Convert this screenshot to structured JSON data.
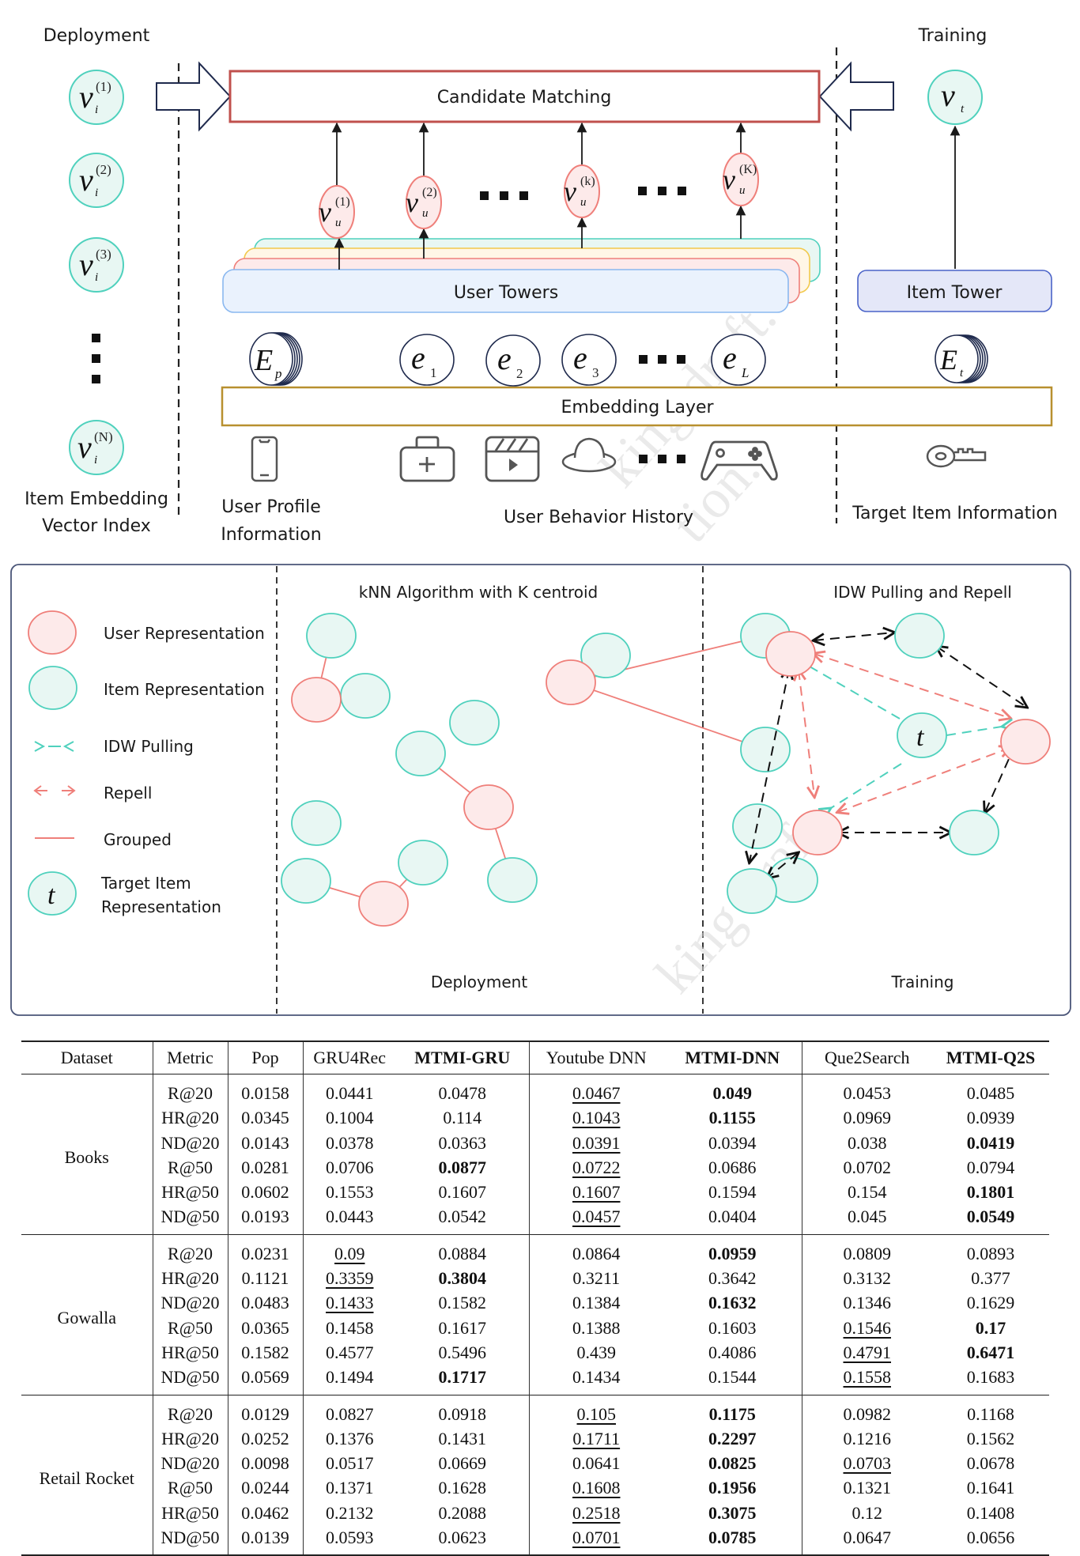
{
  "architecture": {
    "deployment_label": "Deployment",
    "training_label": "Training",
    "candidate_matching_label": "Candidate Matching",
    "user_towers_label": "User Towers",
    "item_tower_label": "Item Tower",
    "embedding_layer_label": "Embedding Layer",
    "item_index_label_line1": "Item Embedding",
    "item_index_label_line2": "Vector Index",
    "user_profile_label_line1": "User Profile",
    "user_profile_label_line2": "Information",
    "user_behavior_label": "User Behavior History",
    "target_item_label": "Target Item Information",
    "item_vectors": [
      {
        "base": "v",
        "sub": "i",
        "sup": "(1)"
      },
      {
        "base": "v",
        "sub": "i",
        "sup": "(2)"
      },
      {
        "base": "v",
        "sub": "i",
        "sup": "(3)"
      },
      {
        "base": "v",
        "sub": "i",
        "sup": "(N)"
      }
    ],
    "user_vectors": [
      {
        "base": "v",
        "sub": "u",
        "sup": "(1)"
      },
      {
        "base": "v",
        "sub": "u",
        "sup": "(2)"
      },
      {
        "base": "v",
        "sub": "u",
        "sup": "(k)"
      },
      {
        "base": "v",
        "sub": "u",
        "sup": "(K)"
      }
    ],
    "target_vector": {
      "base": "v",
      "sub": "t"
    },
    "profile_embedding": {
      "base": "E",
      "sub": "p"
    },
    "target_embedding": {
      "base": "E",
      "sub": "t"
    },
    "behavior_embeddings": [
      {
        "base": "e",
        "sub": "1"
      },
      {
        "base": "e",
        "sub": "2"
      },
      {
        "base": "e",
        "sub": "3"
      },
      {
        "base": "e",
        "sub": "L"
      }
    ],
    "behavior_icons": [
      "first-aid-kit-icon",
      "video-clapper-icon",
      "hat-icon",
      "game-controller-icon"
    ],
    "profile_icon": "smartphone-icon",
    "target_icon": "key-icon"
  },
  "legend": {
    "items": [
      {
        "label": "User Representation",
        "kind": "user"
      },
      {
        "label": "Item Representation",
        "kind": "item"
      },
      {
        "label": "IDW Pulling",
        "kind": "pull"
      },
      {
        "label": "Repell",
        "kind": "repel"
      },
      {
        "label": "Grouped",
        "kind": "grouped"
      },
      {
        "label_line1": "Target Item",
        "label_line2": "Representation",
        "kind": "target",
        "symbol": "t"
      }
    ]
  },
  "knn_panel": {
    "title": "kNN Algorithm with K centroid",
    "caption": "Deployment"
  },
  "idw_panel": {
    "title": "IDW Pulling and Repell",
    "caption": "Training",
    "target_symbol": "t"
  },
  "colors": {
    "user_fill": "#fdeaea",
    "user_stroke": "#ef7f7a",
    "item_fill": "#e8f7f3",
    "item_stroke": "#4fd1bd",
    "candidate_box": "#c0504d",
    "embedding_box": "#b8902f",
    "tower_blue_fill": "#eaf2fd",
    "tower_blue_stroke": "#8ab8f0",
    "item_tower_fill": "#e4e7f8",
    "item_tower_stroke": "#4a63c8",
    "arrow_navy": "#1f2a4d"
  },
  "watermark": [
    "king draft.",
    "tion."
  ],
  "table": {
    "headers": [
      {
        "label": "Dataset",
        "bold": false
      },
      {
        "label": "Metric",
        "bold": false
      },
      {
        "label": "Pop",
        "bold": false
      },
      {
        "label": "GRU4Rec",
        "bold": false
      },
      {
        "label": "MTMI-GRU",
        "bold": true
      },
      {
        "label": "Youtube DNN",
        "bold": false
      },
      {
        "label": "MTMI-DNN",
        "bold": true
      },
      {
        "label": "Que2Search",
        "bold": false
      },
      {
        "label": "MTMI-Q2S",
        "bold": true
      }
    ],
    "groups": [
      {
        "dataset": "Books",
        "rows": [
          {
            "metric": "R@20",
            "values": [
              "0.0158",
              "0.0441",
              "0.0478",
              "0.0467",
              "0.049",
              "0.0453",
              "0.0485"
            ],
            "bold": [
              4
            ],
            "underline": [
              3
            ]
          },
          {
            "metric": "HR@20",
            "values": [
              "0.0345",
              "0.1004",
              "0.114",
              "0.1043",
              "0.1155",
              "0.0969",
              "0.0939"
            ],
            "bold": [
              4
            ],
            "underline": [
              3
            ]
          },
          {
            "metric": "ND@20",
            "values": [
              "0.0143",
              "0.0378",
              "0.0363",
              "0.0391",
              "0.0394",
              "0.038",
              "0.0419"
            ],
            "bold": [
              6
            ],
            "underline": [
              3
            ]
          },
          {
            "metric": "R@50",
            "values": [
              "0.0281",
              "0.0706",
              "0.0877",
              "0.0722",
              "0.0686",
              "0.0702",
              "0.0794"
            ],
            "bold": [
              2
            ],
            "underline": [
              3
            ]
          },
          {
            "metric": "HR@50",
            "values": [
              "0.0602",
              "0.1553",
              "0.1607",
              "0.1607",
              "0.1594",
              "0.154",
              "0.1801"
            ],
            "bold": [
              6
            ],
            "underline": [
              3
            ]
          },
          {
            "metric": "ND@50",
            "values": [
              "0.0193",
              "0.0443",
              "0.0542",
              "0.0457",
              "0.0404",
              "0.045",
              "0.0549"
            ],
            "bold": [
              6
            ],
            "underline": [
              3
            ]
          }
        ]
      },
      {
        "dataset": "Gowalla",
        "rows": [
          {
            "metric": "R@20",
            "values": [
              "0.0231",
              "0.09",
              "0.0884",
              "0.0864",
              "0.0959",
              "0.0809",
              "0.0893"
            ],
            "bold": [
              4
            ],
            "underline": [
              1
            ]
          },
          {
            "metric": "HR@20",
            "values": [
              "0.1121",
              "0.3359",
              "0.3804",
              "0.3211",
              "0.3642",
              "0.3132",
              "0.377"
            ],
            "bold": [
              2
            ],
            "underline": [
              1
            ]
          },
          {
            "metric": "ND@20",
            "values": [
              "0.0483",
              "0.1433",
              "0.1582",
              "0.1384",
              "0.1632",
              "0.1346",
              "0.1629"
            ],
            "bold": [
              4
            ],
            "underline": [
              1
            ]
          },
          {
            "metric": "R@50",
            "values": [
              "0.0365",
              "0.1458",
              "0.1617",
              "0.1388",
              "0.1603",
              "0.1546",
              "0.17"
            ],
            "bold": [
              6
            ],
            "underline": [
              5
            ]
          },
          {
            "metric": "HR@50",
            "values": [
              "0.1582",
              "0.4577",
              "0.5496",
              "0.439",
              "0.4086",
              "0.4791",
              "0.6471"
            ],
            "bold": [
              6
            ],
            "underline": [
              5
            ]
          },
          {
            "metric": "ND@50",
            "values": [
              "0.0569",
              "0.1494",
              "0.1717",
              "0.1434",
              "0.1544",
              "0.1558",
              "0.1683"
            ],
            "bold": [
              2
            ],
            "underline": [
              5
            ]
          }
        ]
      },
      {
        "dataset": "Retail Rocket",
        "rows": [
          {
            "metric": "R@20",
            "values": [
              "0.0129",
              "0.0827",
              "0.0918",
              "0.105",
              "0.1175",
              "0.0982",
              "0.1168"
            ],
            "bold": [
              4
            ],
            "underline": [
              3
            ]
          },
          {
            "metric": "HR@20",
            "values": [
              "0.0252",
              "0.1376",
              "0.1431",
              "0.1711",
              "0.2297",
              "0.1216",
              "0.1562"
            ],
            "bold": [
              4
            ],
            "underline": [
              3
            ]
          },
          {
            "metric": "ND@20",
            "values": [
              "0.0098",
              "0.0517",
              "0.0669",
              "0.0641",
              "0.0825",
              "0.0703",
              "0.0678"
            ],
            "bold": [
              4
            ],
            "underline": [
              5
            ]
          },
          {
            "metric": "R@50",
            "values": [
              "0.0244",
              "0.1371",
              "0.1628",
              "0.1608",
              "0.1956",
              "0.1321",
              "0.1641"
            ],
            "bold": [
              4
            ],
            "underline": [
              3
            ]
          },
          {
            "metric": "HR@50",
            "values": [
              "0.0462",
              "0.2132",
              "0.2088",
              "0.2518",
              "0.3075",
              "0.12",
              "0.1408"
            ],
            "bold": [
              4
            ],
            "underline": [
              3
            ]
          },
          {
            "metric": "ND@50",
            "values": [
              "0.0139",
              "0.0593",
              "0.0623",
              "0.0701",
              "0.0785",
              "0.0647",
              "0.0656"
            ],
            "bold": [
              4
            ],
            "underline": [
              3
            ]
          }
        ]
      }
    ]
  }
}
